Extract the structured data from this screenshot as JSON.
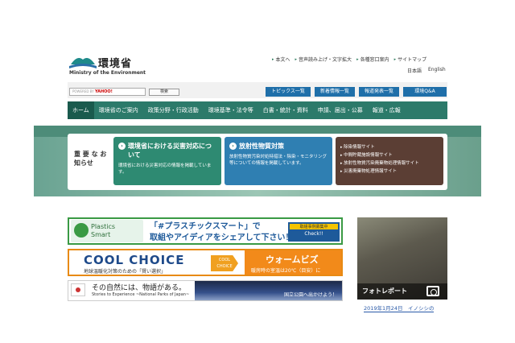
{
  "header": {
    "logo_name": "環境省",
    "logo_en": "Ministry of the Environment",
    "links": [
      "本文へ",
      "音声読み上げ・文字拡大",
      "各種窓口案内",
      "サイトマップ"
    ],
    "langs": [
      "日本語",
      "English"
    ]
  },
  "search": {
    "powered": "POWERED BY",
    "brand": "YAHOO!",
    "button": "検索"
  },
  "top_buttons": [
    "トピックス一覧",
    "新着情報一覧",
    "報道発表一覧",
    "環境Q&A"
  ],
  "nav": [
    "ホーム",
    "環境省のご案内",
    "政策分野・行政活動",
    "環境基準・法令等",
    "白書・統計・資料",
    "申請、届出・公募",
    "報道・広報"
  ],
  "notice": {
    "title": "重 要 な お知らせ",
    "card1": {
      "title": "環境省における災害対応について",
      "desc": "環境省における災害対応の情報を掲載しています。",
      "color": "#2e8a72"
    },
    "card2": {
      "title": "放射性物質対策",
      "desc": "放射性物質汚染対処特措法・除染・モニタリング等についての情報を掲載しています。",
      "color": "#2f7fb2"
    },
    "card3": {
      "items": [
        "除染情報サイト",
        "中間貯蔵施設情報サイト",
        "放射性物質汚染廃棄物処理情報サイト",
        "災害廃棄物処理情報サイト"
      ],
      "color": "#5b3e34"
    }
  },
  "banners": {
    "plastics": {
      "logo1": "Plastics",
      "logo2": "Smart",
      "line1": "「#プラスチックスマート」で",
      "line2": "取組やアイディアをシェアして下さい！",
      "btn_top": "取組事例募集中",
      "btn_bottom": "Check!!"
    },
    "cool": {
      "title": "COOL CHOICE",
      "sub": "地球温暖化対策のための「賢い選択」",
      "mark": "COOL CHOICE",
      "warm": "ウォームビズ",
      "warm_sub": "暖房時の室温は20℃（目安）に"
    },
    "nature": {
      "title": "その自然には、物語がある。",
      "sub": "Stories to Experience ~National Parks of Japan~",
      "img_text": "国立公園へ出かけよう！"
    }
  },
  "photo_report": {
    "label": "フォトレポート",
    "date_text": "2019年1月24日　イノシシの"
  }
}
